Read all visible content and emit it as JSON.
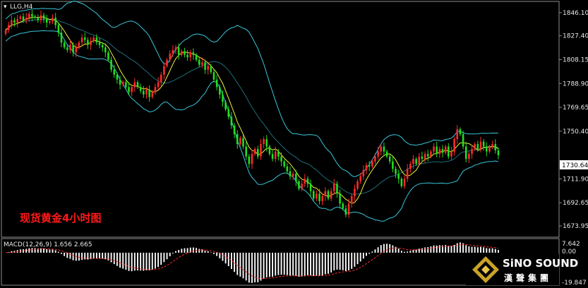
{
  "window": {
    "symbol_label": "LLG,H4",
    "caption": "现货黄金4小时图",
    "current_price": "1730.64"
  },
  "price_axis": {
    "ticks": [
      "1846.10",
      "1827.40",
      "1808.15",
      "1788.90",
      "1769.65",
      "1750.40",
      "1711.90",
      "1692.65",
      "1673.95"
    ]
  },
  "macd": {
    "label": "MACD(12,26,9) 1.656 2.665",
    "ticks": [
      "7.642",
      "0.00",
      "-19.847"
    ]
  },
  "logo": {
    "line1": "SiNO SOUND",
    "line2": "漢聲集團"
  },
  "colors": {
    "background": "#000000",
    "bull_candle": "#ff2a2a",
    "bear_candle": "#22dd22",
    "bollinger": "#39c6d8",
    "moving_average": "#f2f23a",
    "macd_histogram": "#ffffff",
    "macd_signal": "#ff2a2a",
    "caption": "#ff1a1a"
  },
  "chart_data": {
    "type": "candlestick",
    "ylim": [
      1666,
      1854
    ],
    "close_series": [
      1832,
      1836,
      1840,
      1838,
      1841,
      1843,
      1840,
      1842,
      1845,
      1843,
      1842,
      1840,
      1844,
      1841,
      1838,
      1839,
      1842,
      1836,
      1830,
      1822,
      1818,
      1816,
      1820,
      1814,
      1818,
      1822,
      1826,
      1824,
      1820,
      1823,
      1826,
      1822,
      1820,
      1818,
      1814,
      1808,
      1800,
      1796,
      1792,
      1788,
      1790,
      1786,
      1782,
      1786,
      1790,
      1786,
      1783,
      1780,
      1784,
      1778,
      1782,
      1786,
      1790,
      1796,
      1803,
      1808,
      1813,
      1816,
      1818,
      1812,
      1815,
      1812,
      1810,
      1814,
      1812,
      1808,
      1804,
      1806,
      1800,
      1803,
      1798,
      1792,
      1786,
      1780,
      1774,
      1768,
      1762,
      1755,
      1748,
      1740,
      1745,
      1738,
      1730,
      1724,
      1732,
      1736,
      1730,
      1740,
      1744,
      1738,
      1732,
      1728,
      1734,
      1730,
      1726,
      1722,
      1718,
      1714,
      1716,
      1710,
      1704,
      1708,
      1712,
      1708,
      1702,
      1696,
      1700,
      1694,
      1698,
      1702,
      1696,
      1702,
      1708,
      1700,
      1692,
      1688,
      1683,
      1692,
      1698,
      1704,
      1710,
      1714,
      1719,
      1723,
      1722,
      1726,
      1730,
      1734,
      1738,
      1734,
      1730,
      1726,
      1720,
      1716,
      1712,
      1706,
      1712,
      1720,
      1724,
      1728,
      1724,
      1730,
      1728,
      1732,
      1730,
      1734,
      1738,
      1732,
      1736,
      1733,
      1738,
      1730,
      1734,
      1744,
      1752,
      1748,
      1738,
      1728,
      1732,
      1736,
      1740,
      1736,
      1742,
      1738,
      1734,
      1738,
      1740,
      1735,
      1731
    ]
  }
}
